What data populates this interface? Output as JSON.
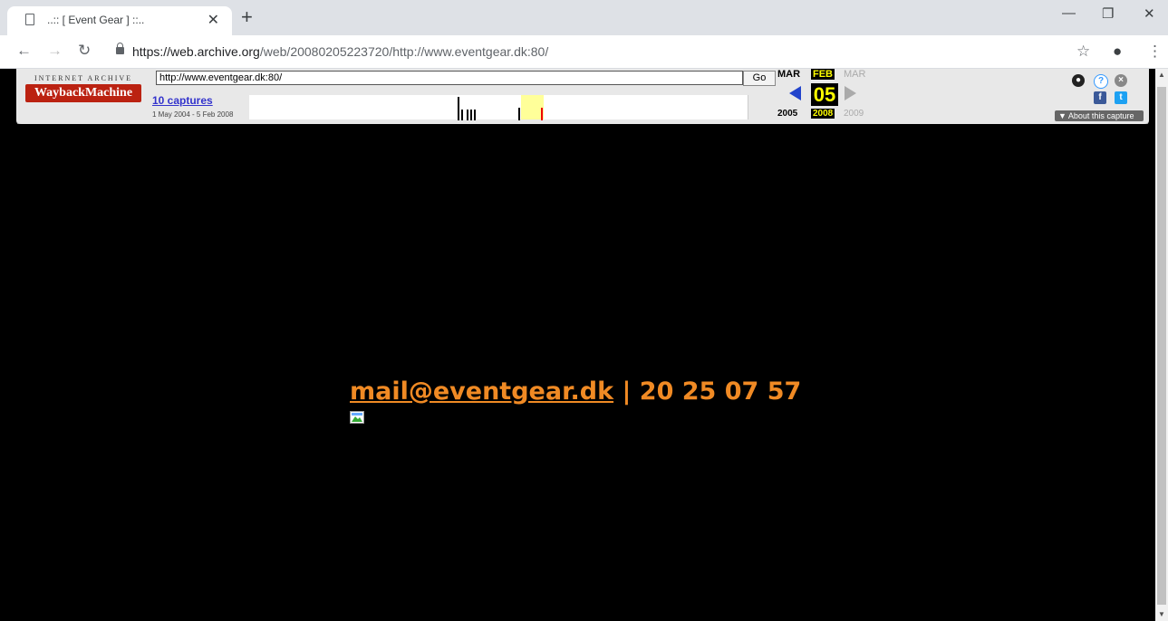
{
  "browser": {
    "tab_title": "..:: [ Event Gear ] ::..",
    "url_host": "https://web.archive.org",
    "url_path": "/web/20080205223720/http://www.eventgear.dk:80/"
  },
  "wayback": {
    "logo_top": "INTERNET ARCHIVE",
    "logo_main": "WaybackMachine",
    "input_value": "http://www.eventgear.dk:80/",
    "go_label": "Go",
    "captures_label": "10 captures",
    "range_label": "1 May 2004 - 5 Feb 2008",
    "prev_month": "MAR",
    "cur_month": "FEB",
    "next_month": "MAR",
    "day": "05",
    "prev_year": "2005",
    "cur_year": "2008",
    "next_year": "2009",
    "about_label": "▼ About this capture"
  },
  "page": {
    "email": "mail@eventgear.dk",
    "separator": "|",
    "phone": "20 25 07 57"
  },
  "colors": {
    "accent": "#f08a24",
    "background": "#000000"
  }
}
